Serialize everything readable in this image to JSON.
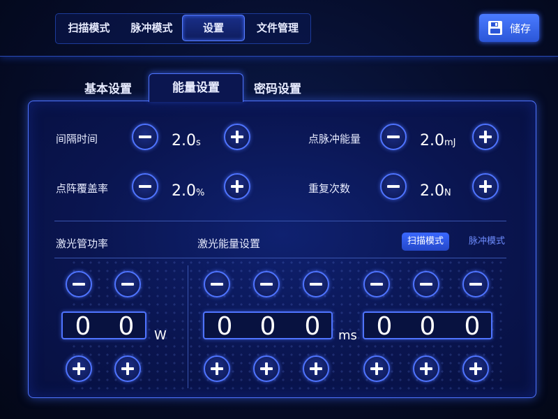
{
  "nav": {
    "items": [
      "扫描模式",
      "脉冲模式",
      "设置",
      "文件管理"
    ],
    "active_index": 2
  },
  "save": {
    "label": "储存",
    "icon": "floppy-disk-icon"
  },
  "tabs": {
    "items": [
      "基本设置",
      "能量设置",
      "密码设置"
    ],
    "active_index": 1
  },
  "settings": {
    "interval": {
      "label": "间隔时间",
      "value": "2.0",
      "unit": "s"
    },
    "dot_energy": {
      "label": "点脉冲能量",
      "value": "2.0",
      "unit": "mJ"
    },
    "coverage": {
      "label": "点阵覆盖率",
      "value": "2.0",
      "unit": "%"
    },
    "repeat": {
      "label": "重复次数",
      "value": "2.0",
      "unit": "N"
    }
  },
  "laser": {
    "power_label": "激光管功率",
    "energy_label": "激光能量设置",
    "modes": [
      "扫描模式",
      "脉冲模式"
    ],
    "active_mode": 0,
    "power_digits": [
      "0",
      "0"
    ],
    "power_unit": "W",
    "ms_digits": [
      "0",
      "0",
      "0"
    ],
    "ms_unit": "ms",
    "third_digits": [
      "0",
      "0",
      "0"
    ]
  },
  "colors": {
    "accent": "#4f74ff",
    "background": "#060d2b",
    "button": "#2b56d8"
  }
}
